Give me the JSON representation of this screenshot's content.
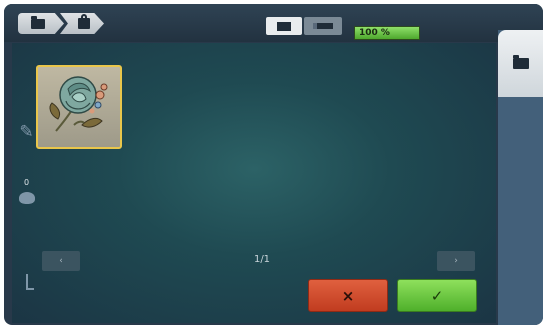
{
  "breadcrumb": {
    "items": [
      {
        "icon": "folder-icon"
      },
      {
        "icon": "embroidery-machine-icon"
      }
    ]
  },
  "toolbar": {
    "zoom_value": "100 %"
  },
  "main": {
    "pager": "1/1",
    "prev_label": "‹",
    "next_label": "›",
    "cancel_label": "×",
    "confirm_label": "✓"
  },
  "sidebar": {
    "palette_badge": "0"
  },
  "colors": {
    "cancel": "#d24f2f",
    "confirm": "#6cc640",
    "zoom": "#6cc640",
    "selection_border": "#e9c64b"
  }
}
